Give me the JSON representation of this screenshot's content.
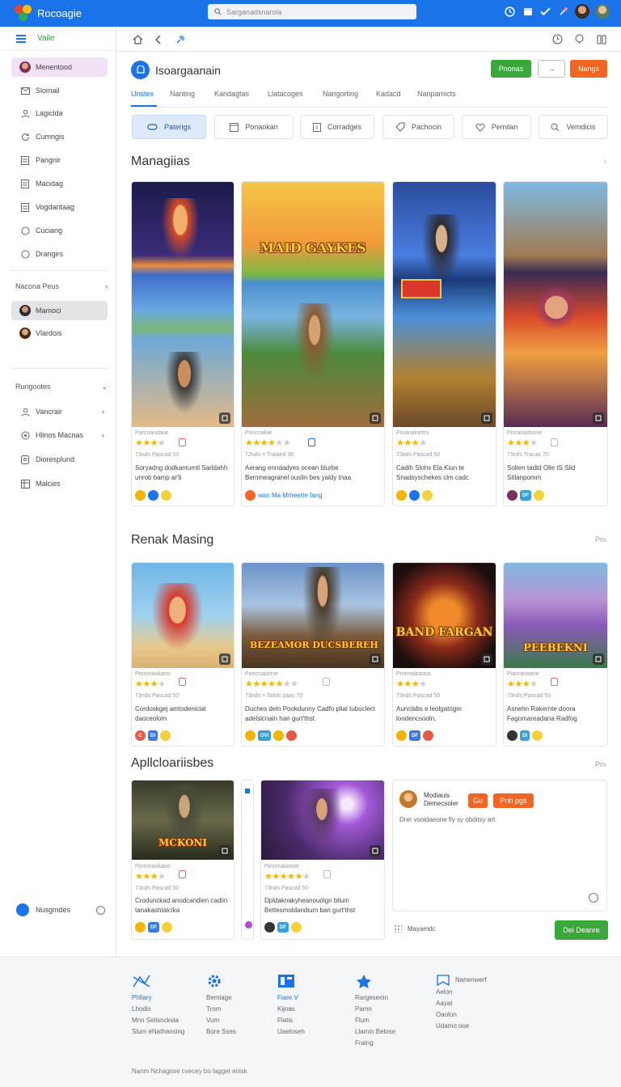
{
  "app": {
    "title": "Rocoagie",
    "search_placeholder": "Sarganadsnarola"
  },
  "sidebar": {
    "header": "Vaile",
    "items": [
      {
        "label": "Menentood",
        "icon": "avatar-icon"
      },
      {
        "label": "Slomail",
        "icon": "mail-icon"
      },
      {
        "label": "Lagiclda",
        "icon": "person-icon"
      },
      {
        "label": "Cumngis",
        "icon": "refresh-icon"
      },
      {
        "label": "Pangnir",
        "icon": "doc-icon"
      },
      {
        "label": "Macidag",
        "icon": "doc-icon"
      },
      {
        "label": "Vogdantaag",
        "icon": "doc-icon"
      },
      {
        "label": "Cuciang",
        "icon": "circle-icon"
      },
      {
        "label": "Drangirs",
        "icon": "circle-icon"
      }
    ],
    "section1": "Nacona Peus",
    "section1_items": [
      {
        "label": "Mamoci"
      },
      {
        "label": "Vlardois"
      }
    ],
    "section2": "Rungootes",
    "section2_items": [
      {
        "label": "Vancrair",
        "icon": "person-icon"
      },
      {
        "label": "Hlinos Macnas",
        "icon": "shield-icon"
      },
      {
        "label": "Dioresplund",
        "icon": "doc-icon"
      },
      {
        "label": "Malcies",
        "icon": "grid-icon"
      }
    ],
    "footer": "Nusgmdes"
  },
  "header": {
    "title": "Isoargaanain",
    "btn_primary": "Pnonas",
    "btn_secondary": "→",
    "btn_accent": "Nangs"
  },
  "tabs": [
    "Unstes",
    "Nanting",
    "Kandagtas",
    "Llatacoges",
    "Nangorting",
    "Kadacd",
    "Nanpamicts"
  ],
  "categories": [
    {
      "label": "Paterigs",
      "icon": "gamepad-icon"
    },
    {
      "label": "Ponaokan",
      "icon": "film-icon"
    },
    {
      "label": "Corradges",
      "icon": "doc-icon"
    },
    {
      "label": "Pachocin",
      "icon": "tag-icon"
    },
    {
      "label": "Pemilan",
      "icon": "heart-icon"
    },
    {
      "label": "Vemdicis",
      "icon": "search-icon"
    }
  ],
  "sections": {
    "s1": {
      "title": "Managiias",
      "more": "›"
    },
    "s2": {
      "title": "Renak Masing",
      "more": "Pri›"
    },
    "s3": {
      "title": "Apllcloariisbes",
      "more": "Pri›"
    }
  },
  "cards_s1": [
    {
      "meta": "Parcnandaue",
      "stars": 3,
      "sub": "73nds Pascad 50",
      "desc": "Soryadng dodkantumtl Sarldahh unrob bamp ar'ti",
      "logo": ""
    },
    {
      "meta": "Poncnaloe",
      "stars": 4,
      "sub": "72nds = Tralaed 36",
      "desc": "Aerang enndadyes ocean blurbe Bemmeagranel ouslin bes yaldy tnaa",
      "logo": "MAID GAYKES",
      "promo": "wan Ma Mmeerte fang"
    },
    {
      "meta": "Pnranainetro",
      "stars": 3,
      "sub": "73nds Pascad 50",
      "desc": "Cadih Slohs Ela Kiun te Snadsyschekes clm cadc",
      "logo": ""
    },
    {
      "meta": "Pinranadsone",
      "stars": 3,
      "sub": "73nds Tracas 70",
      "desc": "Solten tadtd Olle tS Slid Sitlanpomm",
      "logo": ""
    }
  ],
  "cards_s2": [
    {
      "meta": "Pmnrnaokano",
      "stars": 3,
      "sub": "73nds Pascad 50",
      "desc": "Cordoskgej amtodenicial daoceolom"
    },
    {
      "meta": "Poncnaionne",
      "stars": 4,
      "sub": "73nds = Talsls paas 70",
      "desc": "Duches deln Pookdunny Cadfo plial tubuclect adelslcnain han gurt'thst",
      "logo": "BEZEAMOR DUCSBEREH"
    },
    {
      "meta": "Pnmnaikaooa",
      "stars": 3,
      "sub": "73nds Pascad 50",
      "desc": "Aunclabs e leolgatrigm loodencsooln.",
      "logo": "BAND FARGAN"
    },
    {
      "meta": "Pianranaane",
      "stars": 3,
      "sub": "73nds Pascad 50",
      "desc": "Asnehn Rakernte doora Fagomareadana Radfog",
      "logo": "PEEBEKNI"
    }
  ],
  "cards_s3": [
    {
      "meta": "Pmnrnaokano",
      "stars": 3,
      "sub": "73nds Pascad 50",
      "desc": "Crodunckad anodcandien cadiin tanakashtalcika",
      "logo": "MCKONI"
    },
    {
      "meta": "Pmnrnaiionne",
      "stars": 5,
      "sub": "73nds Pascad 50",
      "desc": "Dpldaknakyheanoudign bilum Bettesmoldandium ban gurt'thst"
    }
  ],
  "promo": {
    "name": "Modiauis Demecsoler",
    "btn1": "Gu",
    "btn2": "Pnh pgs",
    "text": "Drer vsoldaeone fiy sy obditsy art",
    "footer": "Mayamdc",
    "cta": "Dei Deanre"
  },
  "footer": {
    "cols": [
      [
        "Phllary",
        "Lhodis",
        "Mnn Selisncksla",
        "Slum éNathansing"
      ],
      [
        "Bemiage",
        "Trom",
        "Vum",
        "Bore Sses"
      ],
      [
        "Fiare V",
        "Kijnas",
        "Flatis",
        "Uaeloseh"
      ],
      [
        "Rargeseoin",
        "Pamn",
        "Flum",
        "Llamin Belose",
        "Fraing"
      ],
      [
        "Nanenwerf",
        "Aelon",
        "Aayat",
        "Oaolon",
        "Udamo ooe"
      ]
    ],
    "copyright": "Nanm Nchagisre cvecey bo lagget enisk"
  },
  "colors": {
    "brand": "#1a73e8",
    "green": "#3aa83a",
    "orange": "#f26522",
    "star": "#f5b400"
  }
}
